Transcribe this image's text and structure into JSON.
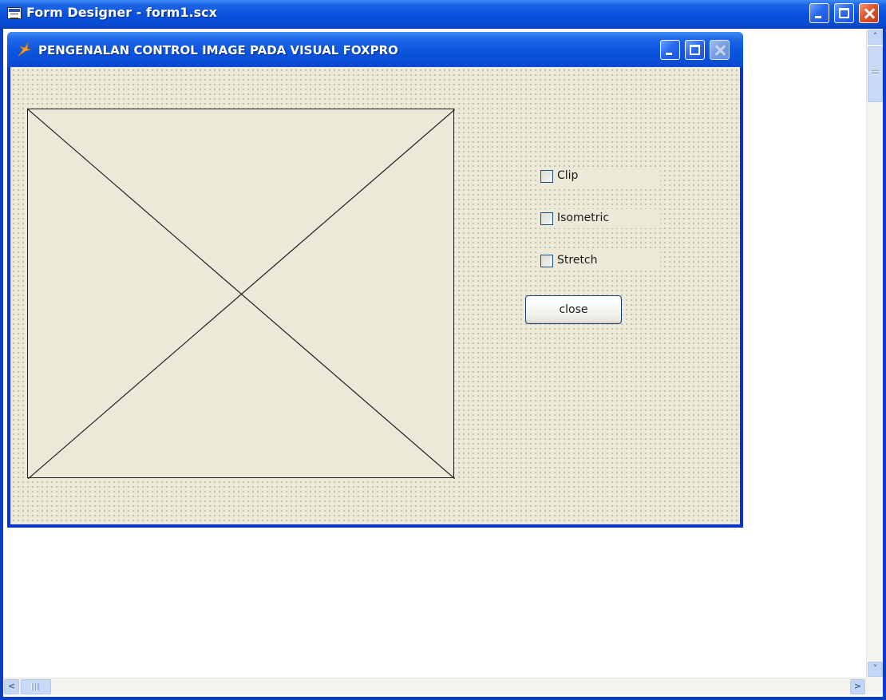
{
  "designer": {
    "title": "Form Designer - form1.scx"
  },
  "form": {
    "title": "PENGENALAN CONTROL IMAGE PADA VISUAL FOXPRO"
  },
  "checkboxes": [
    {
      "label": "Clip",
      "checked": false
    },
    {
      "label": "Isometric",
      "checked": false
    },
    {
      "label": "Stretch",
      "checked": false
    }
  ],
  "close_button": {
    "label": "close"
  },
  "icons": {
    "designer_window": "form-designer-icon",
    "form_window": "foxpro-fox-icon"
  },
  "colors": {
    "titlebar": "#0a4bd2",
    "form_background": "#ece9d8",
    "close_button_red": "#e0552c"
  }
}
